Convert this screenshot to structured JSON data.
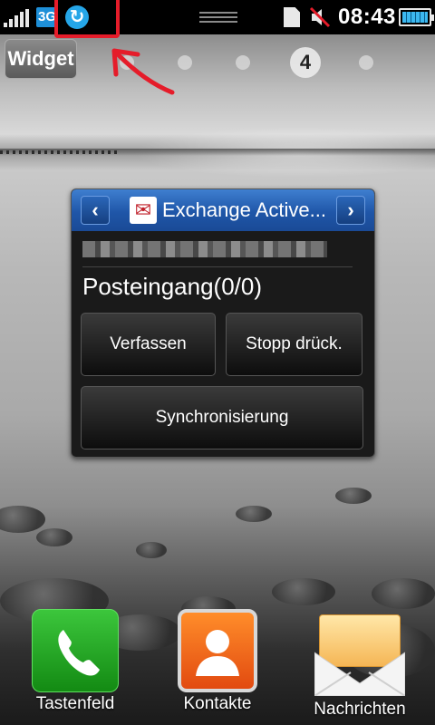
{
  "status_bar": {
    "network_type": "3G",
    "time": "08:43",
    "icons": [
      "signal-icon",
      "network-3g-icon",
      "sync-icon",
      "drag-handle-icon",
      "sd-card-icon",
      "muted-icon",
      "battery-icon"
    ]
  },
  "home": {
    "widget_label": "Widget",
    "current_page": "4"
  },
  "exchange_widget": {
    "title": "Exchange Active...",
    "account": "",
    "inbox": "Posteingang(0/0)",
    "compose_label": "Verfassen",
    "stop_label": "Stopp drück.",
    "sync_label": "Synchronisierung",
    "accent_color": "#2a63b8"
  },
  "dock": [
    {
      "label": "Tastenfeld",
      "icon": "phone-icon"
    },
    {
      "label": "Kontakte",
      "icon": "contacts-icon"
    },
    {
      "label": "Nachrichten",
      "icon": "messages-icon"
    }
  ],
  "annotation_color": "#e51c2a"
}
